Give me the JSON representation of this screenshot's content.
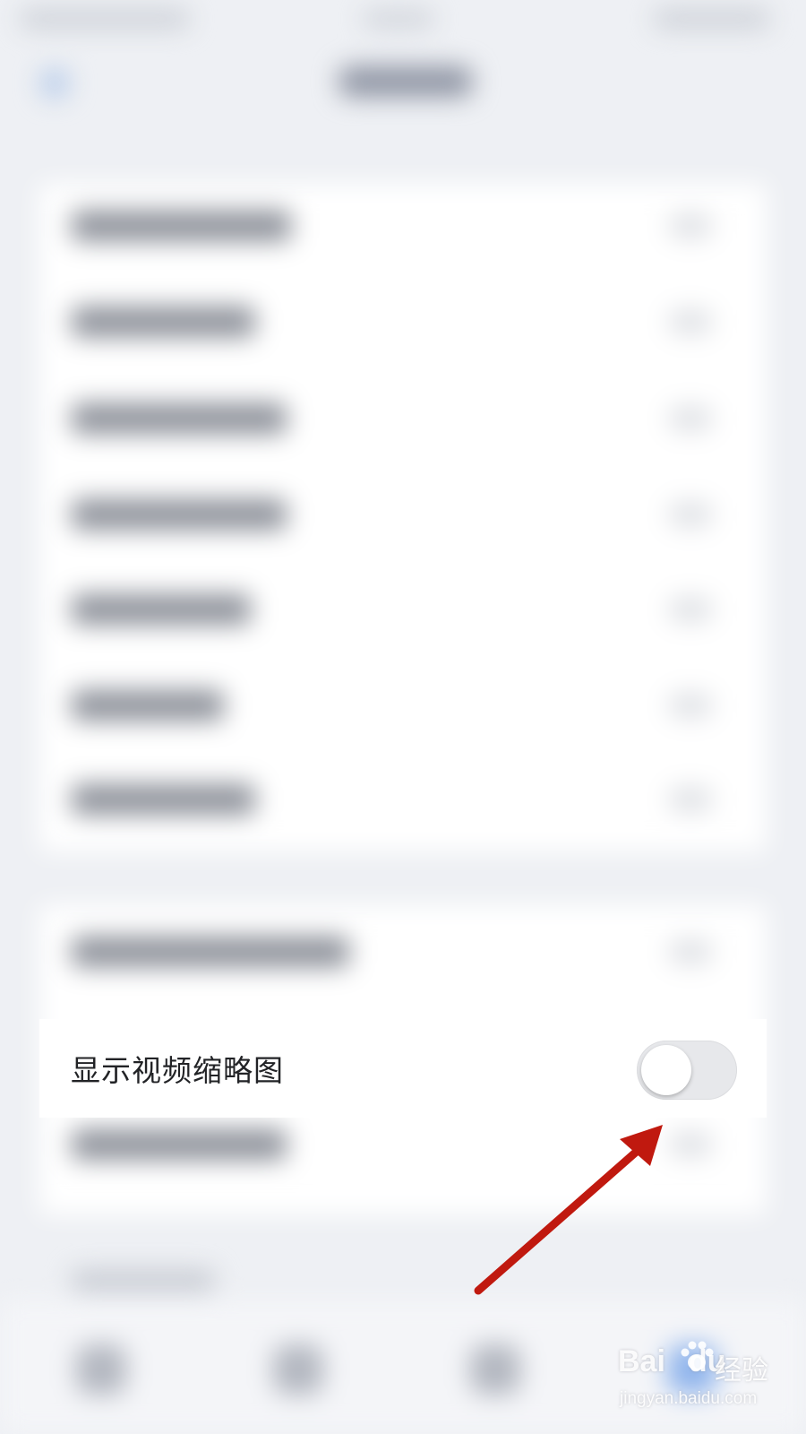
{
  "focus_setting": {
    "label": "显示视频缩略图",
    "toggle_state": "off"
  },
  "annotation": {
    "arrow_color": "#c0190f",
    "points_to": "toggle"
  },
  "watermark": {
    "logo_text": "Bai",
    "logo_text_2": "du",
    "jingyan_text": "经验",
    "url": "jingyan.baidu.com"
  },
  "colors": {
    "background": "#eef0f4",
    "card": "#ffffff",
    "toggle_track_off": "#e7e8eb",
    "label_text": "#222326"
  }
}
